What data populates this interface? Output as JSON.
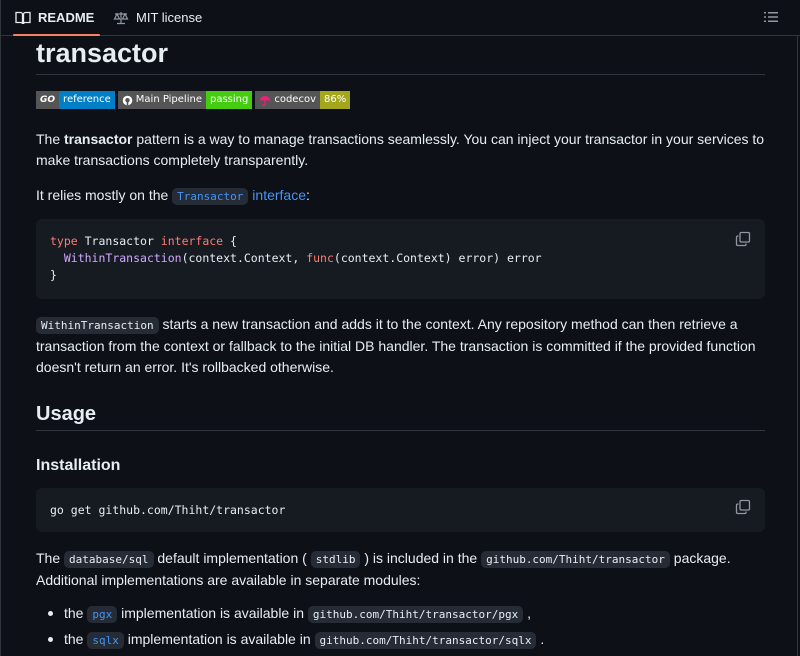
{
  "tabs": {
    "readme_label": "README",
    "license_label": "MIT license"
  },
  "title": "transactor",
  "badges": {
    "go_label": "GO",
    "reference": "reference",
    "pipeline_label": "Main Pipeline",
    "pipeline_status": "passing",
    "codecov_label": "codecov",
    "codecov_value": "86%"
  },
  "intro": {
    "pre": "The ",
    "bold": "transactor",
    "post": " pattern is a way to manage transactions seamlessly. You can inject your transactor in your services to make transactions completely transparently."
  },
  "relies": {
    "pre": "It relies mostly on the ",
    "code_link": "Transactor",
    "link": " interface",
    "post": ":"
  },
  "code_block_1": {
    "line1_kw1": "type",
    "line1_name": " Transactor ",
    "line1_kw2": "interface",
    "line1_rest": " {",
    "line2_indent": "  ",
    "line2_fn": "WithinTransaction",
    "line2_mid": "(context.Context, ",
    "line2_kw": "func",
    "line2_rest": "(context.Context) error) error",
    "line3": "}"
  },
  "within": {
    "code": "WithinTransaction",
    "text": " starts a new transaction and adds it to the context. Any repository method can then retrieve a transaction from the context or fallback to the initial DB handler. The transaction is committed if the provided function doesn't return an error. It's rollbacked otherwise."
  },
  "usage_heading": "Usage",
  "installation_heading": "Installation",
  "code_block_2": "go get github.com/Thiht/transactor",
  "default_impl": {
    "t1": "The ",
    "c1": "database/sql",
    "t2": " default implementation ( ",
    "c2": "stdlib",
    "t3": " ) is included in the ",
    "c3": "github.com/Thiht/transactor",
    "t4": " package. Additional implementations are available in separate modules:"
  },
  "impl_list": [
    {
      "t1": "the ",
      "link": "pgx",
      "t2": " implementation is available in ",
      "code": "github.com/Thiht/transactor/pgx",
      "t3": " ,"
    },
    {
      "t1": "the ",
      "link": "sqlx",
      "t2": " implementation is available in ",
      "code": "github.com/Thiht/transactor/sqlx",
      "t3": " ."
    }
  ]
}
